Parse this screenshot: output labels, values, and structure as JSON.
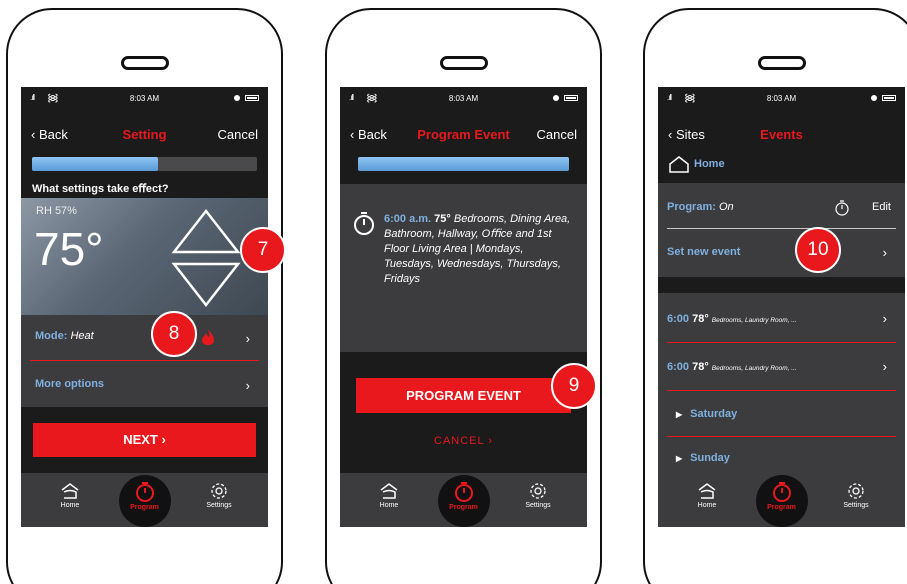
{
  "status": {
    "time": "8:03 AM"
  },
  "phone1": {
    "nav": {
      "back": "Back",
      "title": "Setting",
      "right": "Cancel"
    },
    "progress": 0.56,
    "question": "What settings take eﬀect?",
    "rh": "RH 57%",
    "temperature": "75°",
    "callout_temp": "7",
    "mode_label": "Mode:",
    "mode_value": "Heat",
    "callout_mode": "8",
    "more_options": "More options",
    "next_button": "NEXT"
  },
  "phone2": {
    "nav": {
      "back": "Back",
      "title": "Program Event",
      "right": "Cancel"
    },
    "progress": 1.0,
    "event_time": "6:00 a.m.",
    "event_temp": "75°",
    "event_description": "Bedrooms, Dining Area, Bathroom, Hallway, Oﬃce and 1st Floor Living Area | Mondays, Tuesdays, Wednesdays, Thursdays, Fridays",
    "program_button": "PROGRAM EVENT",
    "callout_program": "9",
    "cancel_button": "CANCEL"
  },
  "phone3": {
    "nav": {
      "back": "Sites",
      "title": "Events"
    },
    "home_label": "Home",
    "program_label": "Program:",
    "program_value": "On",
    "edit_label": "Edit",
    "set_new_event": "Set new event",
    "callout_new": "10",
    "events": [
      {
        "time": "6:00",
        "temp": "78°",
        "rooms": "Bedrooms, Laundry Room, ..."
      },
      {
        "time": "6:00",
        "temp": "78°",
        "rooms": "Bedrooms, Laundry Room, ..."
      }
    ],
    "days": [
      "Saturday",
      "Sunday"
    ]
  },
  "tabs": {
    "home": "Home",
    "program": "Program",
    "settings": "Settings"
  },
  "colors": {
    "accent": "#e8181c",
    "link": "#7fb0e0",
    "screen": "#1b1b1c",
    "panel": "#3c3c3e"
  },
  "icons": [
    "signal-icon",
    "wifi-icon",
    "battery-icon",
    "chevron-left-icon",
    "chevron-right-icon",
    "up-arrow-icon",
    "down-arrow-icon",
    "flame-icon",
    "timer-icon",
    "home-icon",
    "gear-icon"
  ]
}
